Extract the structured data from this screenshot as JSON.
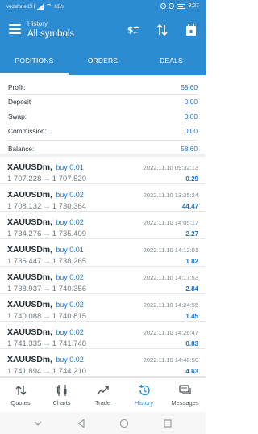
{
  "status_bar": {
    "carrier": "vodafone GH",
    "network_speed": "KB/s",
    "time": "9:27"
  },
  "header": {
    "subtitle": "History",
    "title": "All symbols"
  },
  "tabs": [
    {
      "label": "POSITIONS",
      "active": true
    },
    {
      "label": "ORDERS",
      "active": false
    },
    {
      "label": "DEALS",
      "active": false
    }
  ],
  "summary": {
    "profit": {
      "label": "Profit:",
      "value": "58.60"
    },
    "deposit": {
      "label": "Deposit",
      "value": "0.00"
    },
    "swap": {
      "label": "Swap:",
      "value": "0.00"
    },
    "commission": {
      "label": "Commission:",
      "value": "0.00"
    },
    "balance": {
      "label": "Balance:",
      "value": "58.60"
    }
  },
  "deals": [
    {
      "symbol": "XAUUSDm,",
      "side": "buy 0.01",
      "time": "2022.11.10 09:32:13",
      "open": "1 707.228",
      "close": "1 707.520",
      "profit": "0.29"
    },
    {
      "symbol": "XAUUSDm,",
      "side": "buy 0.02",
      "time": "2022.11.10 13:35:24",
      "open": "1 708.132",
      "close": "1 730.364",
      "profit": "44.47"
    },
    {
      "symbol": "XAUUSDm,",
      "side": "buy 0.02",
      "time": "2022.11.10 14:05:17",
      "open": "1 734.276",
      "close": "1 735.409",
      "profit": "2.27"
    },
    {
      "symbol": "XAUUSDm,",
      "side": "buy 0.01",
      "time": "2022.11.10 14:12:01",
      "open": "1 736.447",
      "close": "1 738.265",
      "profit": "1.82"
    },
    {
      "symbol": "XAUUSDm,",
      "side": "buy 0.02",
      "time": "2022.11.10 14:17:53",
      "open": "1 738.937",
      "close": "1 740.356",
      "profit": "2.84"
    },
    {
      "symbol": "XAUUSDm,",
      "side": "buy 0.02",
      "time": "2022.11.10 14:24:55",
      "open": "1 740.088",
      "close": "1 740.815",
      "profit": "1.45"
    },
    {
      "symbol": "XAUUSDm,",
      "side": "buy 0.02",
      "time": "2022.11.10 14:26:47",
      "open": "1 741.335",
      "close": "1 741.748",
      "profit": "0.83"
    },
    {
      "symbol": "XAUUSDm,",
      "side": "buy 0.02",
      "time": "2022.11.10 14:48:50",
      "open": "1 741.894",
      "close": "1 744.210",
      "profit": "4.63"
    }
  ],
  "arrow": "→",
  "bottom_nav": [
    {
      "label": "Quotes",
      "icon": "quotes-icon",
      "active": false
    },
    {
      "label": "Charts",
      "icon": "charts-icon",
      "active": false
    },
    {
      "label": "Trade",
      "icon": "trade-icon",
      "active": false
    },
    {
      "label": "History",
      "icon": "history-icon",
      "active": true
    },
    {
      "label": "Messages",
      "icon": "messages-icon",
      "active": false
    }
  ],
  "colors": {
    "header": "#2d8cd1",
    "accent_blue": "#1d6fc4",
    "active_nav": "#2d8cd1"
  }
}
